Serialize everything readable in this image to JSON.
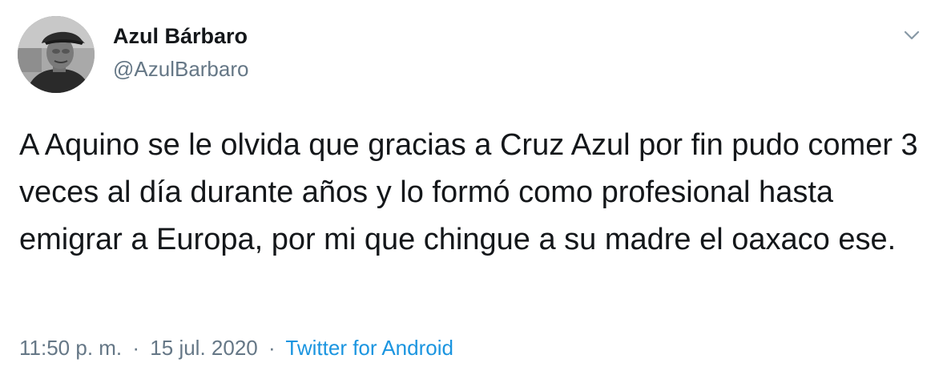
{
  "tweet": {
    "author_name": "Azul Bárbaro",
    "author_handle": "@AzulBarbaro",
    "text": "A Aquino se le olvida que gracias a Cruz Azul por fin pudo comer 3 veces al día durante años y lo formó como profesional hasta emigrar a Europa, por mi que chingue a su madre el oaxaco ese.",
    "time": "11:50 p. m.",
    "separator": "·",
    "date": "15 jul. 2020",
    "source": "Twitter for Android"
  },
  "icons": {
    "menu": "chevron-down-icon",
    "avatar": "avatar"
  },
  "colors": {
    "text": "#14171a",
    "secondary": "#657786",
    "link": "#1b95e0",
    "background": "#ffffff"
  }
}
